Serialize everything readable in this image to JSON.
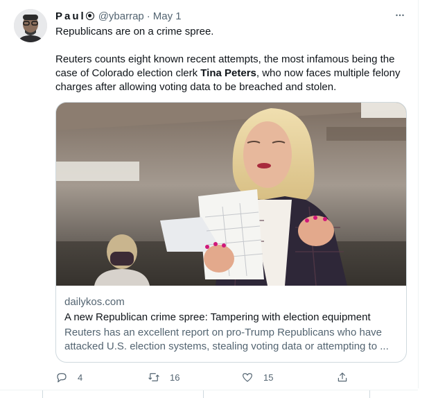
{
  "tweet": {
    "author": {
      "display_name": "Paul",
      "handle": "@ybarrap",
      "badge_icon": "circle-dot-icon"
    },
    "separator": "·",
    "date": "May 1",
    "more_icon": "more-dots-icon",
    "text": {
      "line1": "Republicans are on a crime spree.",
      "para2_before": "Reuters counts eight known recent attempts, the most infamous being the case of Colorado election clerk ",
      "para2_bold": "Tina Peters",
      "para2_after": ", who now faces multiple felony charges after allowing voting data to be breached and stolen."
    },
    "card": {
      "domain": "dailykos.com",
      "title": "A new Republican crime spree: Tampering with election equipment",
      "description": "Reuters has an excellent report on pro-Trump Republicans who have attacked U.S. election systems, stealing voting data or attempting to ..."
    },
    "actions": {
      "reply_count": "4",
      "retweet_count": "16",
      "like_count": "15",
      "reply_icon": "reply-icon",
      "retweet_icon": "retweet-icon",
      "like_icon": "heart-icon",
      "share_icon": "share-icon"
    },
    "colors": {
      "text_primary": "#0f1419",
      "text_secondary": "#536471",
      "border": "#cfd9de"
    }
  }
}
